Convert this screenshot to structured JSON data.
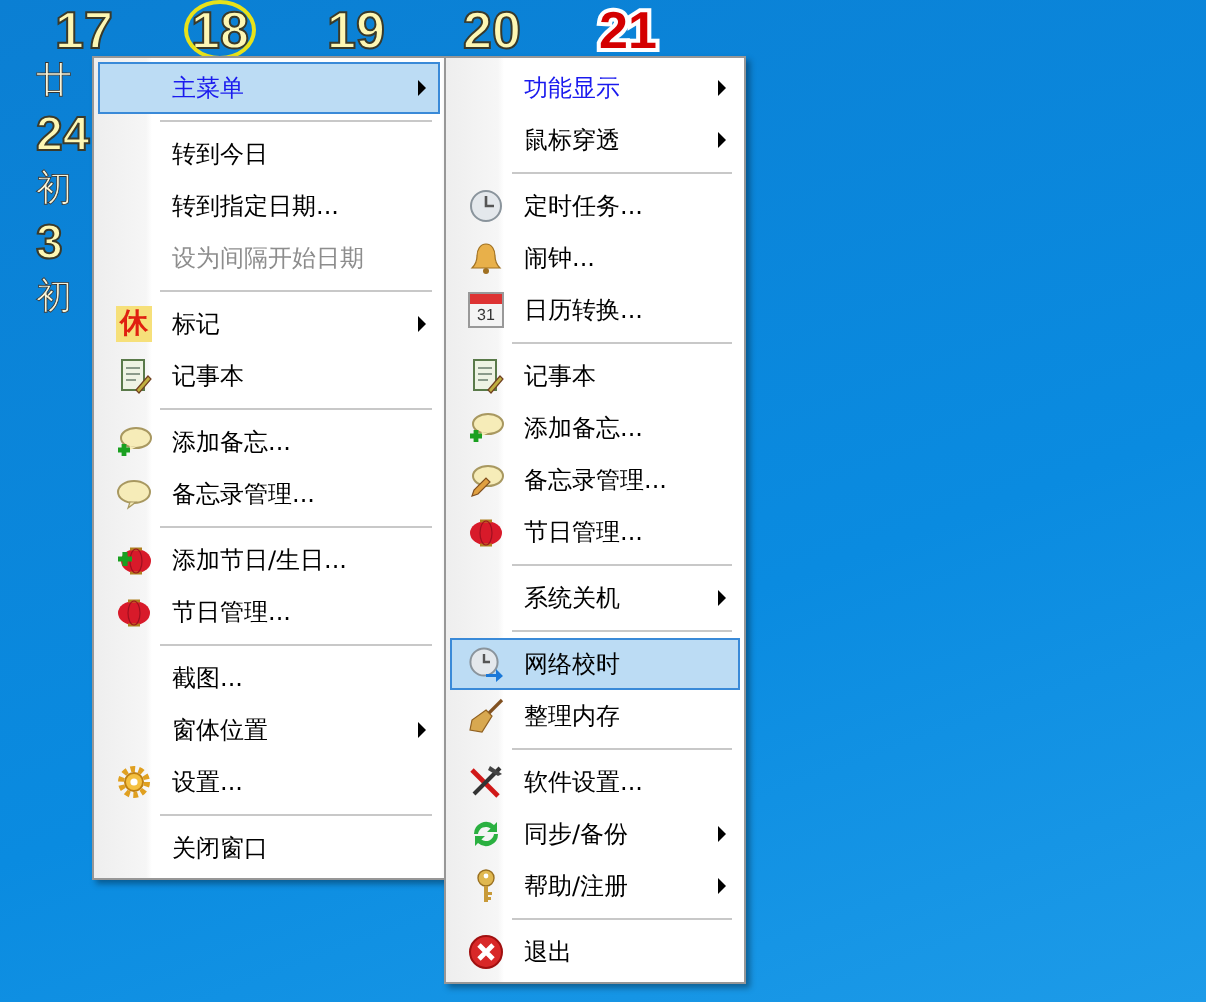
{
  "calendar": {
    "top_row": [
      {
        "day": "17",
        "today": false,
        "holiday": false
      },
      {
        "day": "18",
        "today": true,
        "holiday": false
      },
      {
        "day": "19",
        "today": false,
        "holiday": false
      },
      {
        "day": "20",
        "today": false,
        "holiday": false
      },
      {
        "day": "21",
        "today": false,
        "holiday": true
      }
    ],
    "left_column": [
      {
        "text": "廿",
        "kind": "lunar"
      },
      {
        "text": "24",
        "kind": "day"
      },
      {
        "text": "初",
        "kind": "lunar"
      },
      {
        "text": "3",
        "kind": "day"
      },
      {
        "text": "初",
        "kind": "lunar"
      }
    ]
  },
  "menus": [
    {
      "items": [
        {
          "kind": "item",
          "label": "主菜单",
          "submenu": true,
          "disabled": false,
          "selected": true,
          "active": true
        },
        {
          "kind": "separator"
        },
        {
          "kind": "item",
          "label": "转到今日",
          "submenu": false,
          "disabled": false,
          "selected": false,
          "active": false
        },
        {
          "kind": "item",
          "label": "转到指定日期...",
          "submenu": false,
          "disabled": false,
          "selected": false,
          "active": false
        },
        {
          "kind": "item",
          "label": "设为间隔开始日期",
          "submenu": false,
          "disabled": true,
          "selected": false,
          "active": false
        },
        {
          "kind": "separator"
        },
        {
          "kind": "item",
          "label": "标记",
          "submenu": true,
          "disabled": false,
          "selected": false,
          "active": false,
          "badge": "休"
        },
        {
          "kind": "item",
          "label": "记事本",
          "submenu": false,
          "disabled": false,
          "selected": false,
          "active": false
        },
        {
          "kind": "separator"
        },
        {
          "kind": "item",
          "label": "添加备忘...",
          "submenu": false,
          "disabled": false,
          "selected": false,
          "active": false
        },
        {
          "kind": "item",
          "label": "备忘录管理...",
          "submenu": false,
          "disabled": false,
          "selected": false,
          "active": false
        },
        {
          "kind": "separator"
        },
        {
          "kind": "item",
          "label": "添加节日/生日...",
          "submenu": false,
          "disabled": false,
          "selected": false,
          "active": false
        },
        {
          "kind": "item",
          "label": "节日管理...",
          "submenu": false,
          "disabled": false,
          "selected": false,
          "active": false
        },
        {
          "kind": "separator"
        },
        {
          "kind": "item",
          "label": "截图...",
          "submenu": false,
          "disabled": false,
          "selected": false,
          "active": false
        },
        {
          "kind": "item",
          "label": "窗体位置",
          "submenu": true,
          "disabled": false,
          "selected": false,
          "active": false
        },
        {
          "kind": "item",
          "label": "设置...",
          "submenu": false,
          "disabled": false,
          "selected": false,
          "active": false
        },
        {
          "kind": "separator"
        },
        {
          "kind": "item",
          "label": "关闭窗口",
          "submenu": false,
          "disabled": false,
          "selected": false,
          "active": false
        }
      ]
    },
    {
      "items": [
        {
          "kind": "item",
          "label": "功能显示",
          "submenu": true,
          "disabled": false,
          "selected": false,
          "active": true
        },
        {
          "kind": "item",
          "label": "鼠标穿透",
          "submenu": true,
          "disabled": false,
          "selected": false,
          "active": false
        },
        {
          "kind": "separator"
        },
        {
          "kind": "item",
          "label": "定时任务...",
          "submenu": false,
          "disabled": false,
          "selected": false,
          "active": false
        },
        {
          "kind": "item",
          "label": "闹钟...",
          "submenu": false,
          "disabled": false,
          "selected": false,
          "active": false
        },
        {
          "kind": "item",
          "label": "日历转换...",
          "submenu": false,
          "disabled": false,
          "selected": false,
          "active": false,
          "badge": "31"
        },
        {
          "kind": "separator"
        },
        {
          "kind": "item",
          "label": "记事本",
          "submenu": false,
          "disabled": false,
          "selected": false,
          "active": false
        },
        {
          "kind": "item",
          "label": "添加备忘...",
          "submenu": false,
          "disabled": false,
          "selected": false,
          "active": false
        },
        {
          "kind": "item",
          "label": "备忘录管理...",
          "submenu": false,
          "disabled": false,
          "selected": false,
          "active": false
        },
        {
          "kind": "item",
          "label": "节日管理...",
          "submenu": false,
          "disabled": false,
          "selected": false,
          "active": false
        },
        {
          "kind": "separator"
        },
        {
          "kind": "item",
          "label": "系统关机",
          "submenu": true,
          "disabled": false,
          "selected": false,
          "active": false
        },
        {
          "kind": "separator"
        },
        {
          "kind": "item",
          "label": "网络校时",
          "submenu": false,
          "disabled": false,
          "selected": true,
          "active": false
        },
        {
          "kind": "item",
          "label": "整理内存",
          "submenu": false,
          "disabled": false,
          "selected": false,
          "active": false
        },
        {
          "kind": "separator"
        },
        {
          "kind": "item",
          "label": "软件设置...",
          "submenu": false,
          "disabled": false,
          "selected": false,
          "active": false
        },
        {
          "kind": "item",
          "label": "同步/备份",
          "submenu": true,
          "disabled": false,
          "selected": false,
          "active": false
        },
        {
          "kind": "item",
          "label": "帮助/注册",
          "submenu": true,
          "disabled": false,
          "selected": false,
          "active": false
        },
        {
          "kind": "separator"
        },
        {
          "kind": "item",
          "label": "退出",
          "submenu": false,
          "disabled": false,
          "selected": false,
          "active": false
        }
      ]
    }
  ]
}
